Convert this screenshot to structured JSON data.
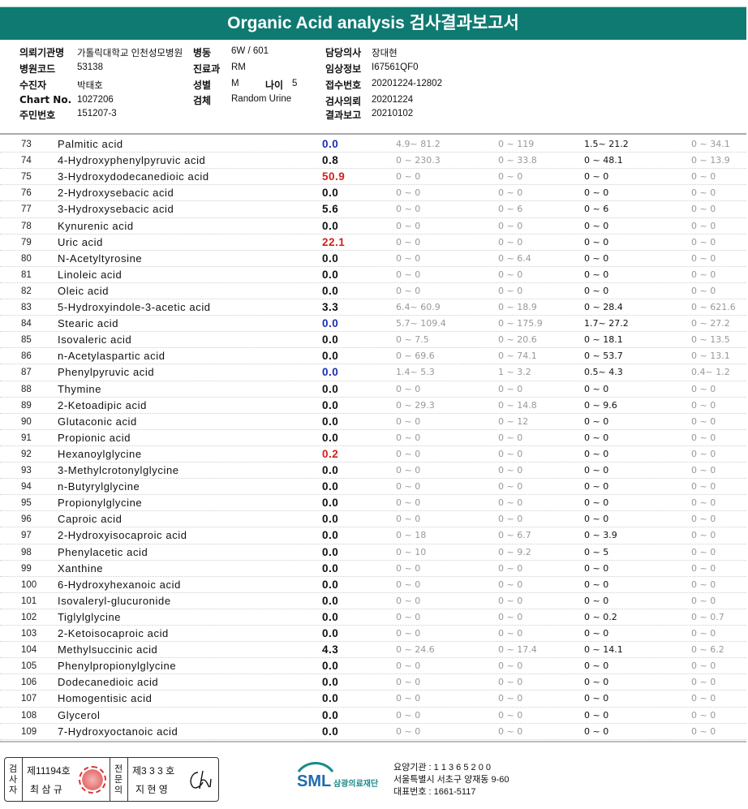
{
  "title": "Organic Acid analysis 검사결과보고서",
  "info": {
    "institution_label": "의뢰기관명",
    "institution": "가톨릭대학교 인천성모병원",
    "ward_label": "병동",
    "ward": "6W / 601",
    "doctor_label": "담당의사",
    "doctor": "장대현",
    "hospital_code_label": "병원코드",
    "hospital_code": "53138",
    "dept_label": "진료과",
    "dept": "RM",
    "clinical_label": "임상정보",
    "clinical": "I67561QF0",
    "collector_label": "수진자",
    "collector": "박태호",
    "sex_label": "성별",
    "sex": "M",
    "age_label": "나이",
    "age": "5",
    "receipt_label": "접수번호",
    "receipt": "20201224-12802",
    "chart_label": "Chart No.",
    "chart": "1027206",
    "specimen_label": "검체",
    "specimen": "Random Urine",
    "request_label": "검사의뢰",
    "request": "20201224",
    "id_label": "주민번호",
    "id": "151207-3",
    "report_label": "결과보고",
    "report": "20210102"
  },
  "rows": [
    {
      "no": "73",
      "name": "Palmitic acid",
      "result": "0.0",
      "color": "#1a2fb0",
      "r1": "4.9~ 81.2",
      "r2": "0 ~ 119",
      "r3": "1.5~ 21.2",
      "r4": "0 ~ 34.1"
    },
    {
      "no": "74",
      "name": "4-Hydroxyphenylpyruvic acid",
      "result": "0.8",
      "color": "#111111",
      "r1": "0 ~ 230.3",
      "r2": "0 ~ 33.8",
      "r3": "0 ~ 48.1",
      "r4": "0 ~ 13.9"
    },
    {
      "no": "75",
      "name": "3-Hydroxydodecanedioic acid",
      "result": "50.9",
      "color": "#d0201b",
      "r1": "0 ~ 0",
      "r2": "0 ~ 0",
      "r3": "0 ~ 0",
      "r4": "0 ~ 0"
    },
    {
      "no": "76",
      "name": "2-Hydroxysebacic acid",
      "result": "0.0",
      "color": "#111111",
      "r1": "0 ~ 0",
      "r2": "0 ~ 0",
      "r3": "0 ~ 0",
      "r4": "0 ~ 0"
    },
    {
      "no": "77",
      "name": "3-Hydroxysebacic acid",
      "result": "5.6",
      "color": "#111111",
      "r1": "0 ~ 0",
      "r2": "0 ~ 6",
      "r3": "0 ~ 6",
      "r4": "0 ~ 0"
    },
    {
      "no": "78",
      "name": "Kynurenic acid",
      "result": "0.0",
      "color": "#111111",
      "r1": "0 ~ 0",
      "r2": "0 ~ 0",
      "r3": "0 ~ 0",
      "r4": "0 ~ 0"
    },
    {
      "no": "79",
      "name": "Uric acid",
      "result": "22.1",
      "color": "#d0201b",
      "r1": "0 ~ 0",
      "r2": "0 ~ 0",
      "r3": "0 ~ 0",
      "r4": "0 ~ 0"
    },
    {
      "no": "80",
      "name": "N-Acetyltyrosine",
      "result": "0.0",
      "color": "#111111",
      "r1": "0 ~ 0",
      "r2": "0 ~ 6.4",
      "r3": "0 ~ 0",
      "r4": "0 ~ 0"
    },
    {
      "no": "81",
      "name": "Linoleic acid",
      "result": "0.0",
      "color": "#111111",
      "r1": "0 ~ 0",
      "r2": "0 ~ 0",
      "r3": "0 ~ 0",
      "r4": "0 ~ 0"
    },
    {
      "no": "82",
      "name": "Oleic acid",
      "result": "0.0",
      "color": "#111111",
      "r1": "0 ~ 0",
      "r2": "0 ~ 0",
      "r3": "0 ~ 0",
      "r4": "0 ~ 0"
    },
    {
      "no": "83",
      "name": "5-Hydroxyindole-3-acetic acid",
      "result": "3.3",
      "color": "#111111",
      "r1": "6.4~ 60.9",
      "r2": "0 ~ 18.9",
      "r3": "0 ~ 28.4",
      "r4": "0 ~ 621.6"
    },
    {
      "no": "84",
      "name": "Stearic acid",
      "result": "0.0",
      "color": "#1a2fb0",
      "r1": "5.7~ 109.4",
      "r2": "0 ~ 175.9",
      "r3": "1.7~ 27.2",
      "r4": "0 ~ 27.2"
    },
    {
      "no": "85",
      "name": "Isovaleric acid",
      "result": "0.0",
      "color": "#111111",
      "r1": "0 ~ 7.5",
      "r2": "0 ~ 20.6",
      "r3": "0 ~ 18.1",
      "r4": "0 ~ 13.5"
    },
    {
      "no": "86",
      "name": "n-Acetylaspartic acid",
      "result": "0.0",
      "color": "#111111",
      "r1": "0 ~ 69.6",
      "r2": "0 ~ 74.1",
      "r3": "0 ~ 53.7",
      "r4": "0 ~ 13.1"
    },
    {
      "no": "87",
      "name": "Phenylpyruvic acid",
      "result": "0.0",
      "color": "#1a2fb0",
      "r1": "1.4~ 5.3",
      "r2": "1 ~ 3.2",
      "r3": "0.5~ 4.3",
      "r4": "0.4~ 1.2"
    },
    {
      "no": "88",
      "name": "Thymine",
      "result": "0.0",
      "color": "#111111",
      "r1": "0 ~ 0",
      "r2": "0 ~ 0",
      "r3": "0 ~ 0",
      "r4": "0 ~ 0"
    },
    {
      "no": "89",
      "name": "2-Ketoadipic acid",
      "result": "0.0",
      "color": "#111111",
      "r1": "0 ~ 29.3",
      "r2": "0 ~ 14.8",
      "r3": "0 ~ 9.6",
      "r4": "0 ~ 0"
    },
    {
      "no": "90",
      "name": "Glutaconic acid",
      "result": "0.0",
      "color": "#111111",
      "r1": "0 ~ 0",
      "r2": "0 ~ 12",
      "r3": "0 ~ 0",
      "r4": "0 ~ 0"
    },
    {
      "no": "91",
      "name": "Propionic acid",
      "result": "0.0",
      "color": "#111111",
      "r1": "0 ~ 0",
      "r2": "0 ~ 0",
      "r3": "0 ~ 0",
      "r4": "0 ~ 0"
    },
    {
      "no": "92",
      "name": "Hexanoylglycine",
      "result": "0.2",
      "color": "#d0201b",
      "r1": "0 ~ 0",
      "r2": "0 ~ 0",
      "r3": "0 ~ 0",
      "r4": "0 ~ 0"
    },
    {
      "no": "93",
      "name": "3-Methylcrotonylglycine",
      "result": "0.0",
      "color": "#111111",
      "r1": "0 ~ 0",
      "r2": "0 ~ 0",
      "r3": "0 ~ 0",
      "r4": "0 ~ 0"
    },
    {
      "no": "94",
      "name": "n-Butyrylglycine",
      "result": "0.0",
      "color": "#111111",
      "r1": "0 ~ 0",
      "r2": "0 ~ 0",
      "r3": "0 ~ 0",
      "r4": "0 ~ 0"
    },
    {
      "no": "95",
      "name": "Propionylglycine",
      "result": "0.0",
      "color": "#111111",
      "r1": "0 ~ 0",
      "r2": "0 ~ 0",
      "r3": "0 ~ 0",
      "r4": "0 ~ 0"
    },
    {
      "no": "96",
      "name": "Caproic acid",
      "result": "0.0",
      "color": "#111111",
      "r1": "0 ~ 0",
      "r2": "0 ~ 0",
      "r3": "0 ~ 0",
      "r4": "0 ~ 0"
    },
    {
      "no": "97",
      "name": "2-Hydroxyisocaproic acid",
      "result": "0.0",
      "color": "#111111",
      "r1": "0 ~ 18",
      "r2": "0 ~ 6.7",
      "r3": "0 ~ 3.9",
      "r4": "0 ~ 0"
    },
    {
      "no": "98",
      "name": "Phenylacetic acid",
      "result": "0.0",
      "color": "#111111",
      "r1": "0 ~ 10",
      "r2": "0 ~ 9.2",
      "r3": "0 ~ 5",
      "r4": "0 ~ 0"
    },
    {
      "no": "99",
      "name": "Xanthine",
      "result": "0.0",
      "color": "#111111",
      "r1": "0 ~ 0",
      "r2": "0 ~ 0",
      "r3": "0 ~ 0",
      "r4": "0 ~ 0"
    },
    {
      "no": "100",
      "name": "6-Hydroxyhexanoic acid",
      "result": "0.0",
      "color": "#111111",
      "r1": "0 ~ 0",
      "r2": "0 ~ 0",
      "r3": "0 ~ 0",
      "r4": "0 ~ 0"
    },
    {
      "no": "101",
      "name": "Isovaleryl-glucuronide",
      "result": "0.0",
      "color": "#111111",
      "r1": "0 ~ 0",
      "r2": "0 ~ 0",
      "r3": "0 ~ 0",
      "r4": "0 ~ 0"
    },
    {
      "no": "102",
      "name": "Tiglylglycine",
      "result": "0.0",
      "color": "#111111",
      "r1": "0 ~ 0",
      "r2": "0 ~ 0",
      "r3": "0 ~ 0.2",
      "r4": "0 ~ 0.7"
    },
    {
      "no": "103",
      "name": "2-Ketoisocaproic acid",
      "result": "0.0",
      "color": "#111111",
      "r1": "0 ~ 0",
      "r2": "0 ~ 0",
      "r3": "0 ~ 0",
      "r4": "0 ~ 0"
    },
    {
      "no": "104",
      "name": "Methylsuccinic acid",
      "result": "4.3",
      "color": "#111111",
      "r1": "0 ~ 24.6",
      "r2": "0 ~ 17.4",
      "r3": "0 ~ 14.1",
      "r4": "0 ~ 6.2"
    },
    {
      "no": "105",
      "name": "Phenylpropionylglycine",
      "result": "0.0",
      "color": "#111111",
      "r1": "0 ~ 0",
      "r2": "0 ~ 0",
      "r3": "0 ~ 0",
      "r4": "0 ~ 0"
    },
    {
      "no": "106",
      "name": "Dodecanedioic acid",
      "result": "0.0",
      "color": "#111111",
      "r1": "0 ~ 0",
      "r2": "0 ~ 0",
      "r3": "0 ~ 0",
      "r4": "0 ~ 0"
    },
    {
      "no": "107",
      "name": "Homogentisic acid",
      "result": "0.0",
      "color": "#111111",
      "r1": "0 ~ 0",
      "r2": "0 ~ 0",
      "r3": "0 ~ 0",
      "r4": "0 ~ 0"
    },
    {
      "no": "108",
      "name": "Glycerol",
      "result": "0.0",
      "color": "#111111",
      "r1": "0 ~ 0",
      "r2": "0 ~ 0",
      "r3": "0 ~ 0",
      "r4": "0 ~ 0"
    },
    {
      "no": "109",
      "name": "7-Hydroxyoctanoic acid",
      "result": "0.0",
      "color": "#111111",
      "r1": "0 ~ 0",
      "r2": "0 ~ 0",
      "r3": "0 ~ 0",
      "r4": "0 ~ 0"
    }
  ],
  "footer": {
    "examiner_label": "검사자",
    "examiner_no": "제11194호",
    "examiner_name": "최 삼 규",
    "specialist_label": "전문의",
    "specialist_no": "제3 3 3 호",
    "specialist_name": "지 현 영",
    "signature": "Chi",
    "logo_text": "SML",
    "org_name": "삼광의료재단",
    "care_id": "요양기관 : 1 1 3 6 5 2 0 0",
    "address": "서울특별시 서초구 양재동 9-60",
    "phone": "대표번호 : 1661-5117"
  }
}
